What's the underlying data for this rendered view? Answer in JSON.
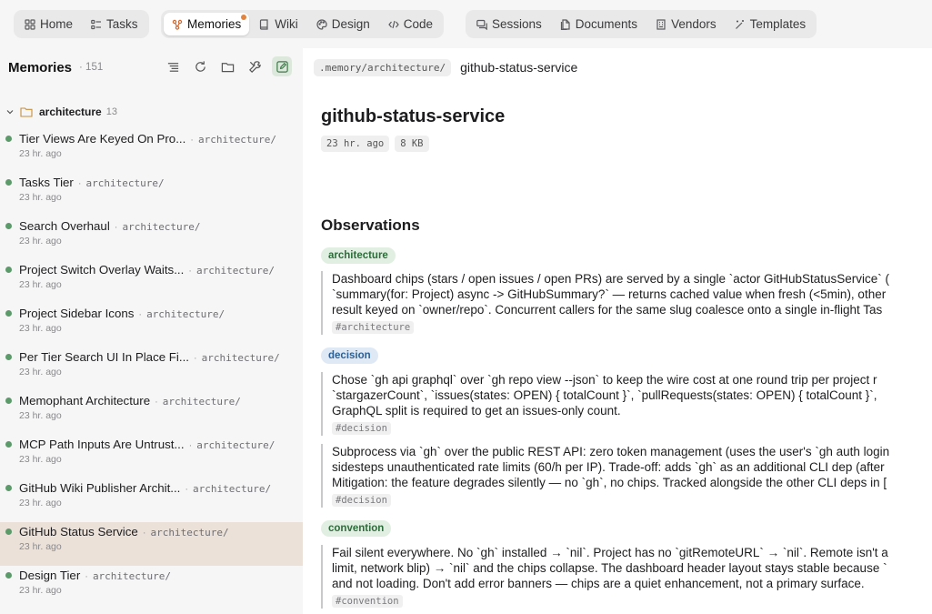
{
  "nav": {
    "group1": [
      {
        "label": "Home",
        "icon": "grid-icon"
      },
      {
        "label": "Tasks",
        "icon": "checklist-icon"
      }
    ],
    "group2": [
      {
        "label": "Memories",
        "icon": "memories-icon",
        "active": true,
        "badge": true
      },
      {
        "label": "Wiki",
        "icon": "book-icon"
      },
      {
        "label": "Design",
        "icon": "palette-icon"
      },
      {
        "label": "Code",
        "icon": "code-icon"
      }
    ],
    "group3": [
      {
        "label": "Sessions",
        "icon": "chat-icon"
      },
      {
        "label": "Documents",
        "icon": "document-icon"
      },
      {
        "label": "Vendors",
        "icon": "building-icon"
      },
      {
        "label": "Templates",
        "icon": "wand-icon"
      }
    ]
  },
  "sidebar": {
    "title": "Memories",
    "count": "· 151",
    "folder": {
      "name": "architecture",
      "count": "13"
    },
    "items": [
      {
        "title": "Tier Views Are Keyed On Pro...",
        "path": "architecture/",
        "time": "23 hr. ago"
      },
      {
        "title": "Tasks Tier",
        "path": "architecture/",
        "time": "23 hr. ago"
      },
      {
        "title": "Search Overhaul",
        "path": "architecture/",
        "time": "23 hr. ago"
      },
      {
        "title": "Project Switch Overlay Waits...",
        "path": "architecture/",
        "time": "23 hr. ago"
      },
      {
        "title": "Project Sidebar Icons",
        "path": "architecture/",
        "time": "23 hr. ago"
      },
      {
        "title": "Per Tier Search UI In Place Fi...",
        "path": "architecture/",
        "time": "23 hr. ago"
      },
      {
        "title": "Memophant Architecture",
        "path": "architecture/",
        "time": "23 hr. ago"
      },
      {
        "title": "MCP Path Inputs Are Untrust...",
        "path": "architecture/",
        "time": "23 hr. ago"
      },
      {
        "title": "GitHub Wiki Publisher Archit...",
        "path": "architecture/",
        "time": "23 hr. ago"
      },
      {
        "title": "GitHub Status Service",
        "path": "architecture/",
        "time": "23 hr. ago",
        "selected": true
      },
      {
        "title": "Design Tier",
        "path": "architecture/",
        "time": "23 hr. ago"
      }
    ]
  },
  "main": {
    "crumb_path": ".memory/architecture/",
    "crumb_name": "github-status-service",
    "title": "github-status-service",
    "age": "23 hr. ago",
    "size": "8 KB",
    "section": "Observations",
    "tags": {
      "architecture": "architecture",
      "decision": "decision",
      "convention": "convention"
    },
    "obs1": [
      "Dashboard chips (stars / open issues / open PRs) are served by a single `actor GitHubStatusService` (",
      "`summary(for: Project) async -> GitHubSummary?` — returns cached value when fresh (<5min), other",
      "result keyed on `owner/repo`. Concurrent callers for the same slug coalesce onto a single in-flight Tas"
    ],
    "obs1_hash": "#architecture",
    "obs2": [
      "Chose `gh api graphql` over `gh repo view --json` to keep the wire cost at one round trip per project r",
      "`stargazerCount`, `issues(states: OPEN) { totalCount }`, `pullRequests(states: OPEN) { totalCount }`,",
      "GraphQL split is required to get an issues-only count."
    ],
    "obs2_hash": "#decision",
    "obs3": [
      "Subprocess via `gh` over the public REST API: zero token management (uses the user's `gh auth login",
      "sidesteps unauthenticated rate limits (60/h per IP). Trade-off: adds `gh` as an additional CLI dep (after",
      "Mitigation: the feature degrades silently — no `gh`, no chips. Tracked alongside the other CLI deps in ["
    ],
    "obs3_hash": "#decision",
    "obs4": [
      "Fail silent everywhere. No `gh` installed → `nil`. Project has no `gitRemoteURL` → `nil`. Remote isn't a",
      "limit, network blip) → `nil` and the chips collapse. The dashboard header layout stays stable because `",
      "and not loading. Don't add error banners — chips are a quiet enhancement, not a primary surface."
    ],
    "obs4_hash": "#convention"
  }
}
